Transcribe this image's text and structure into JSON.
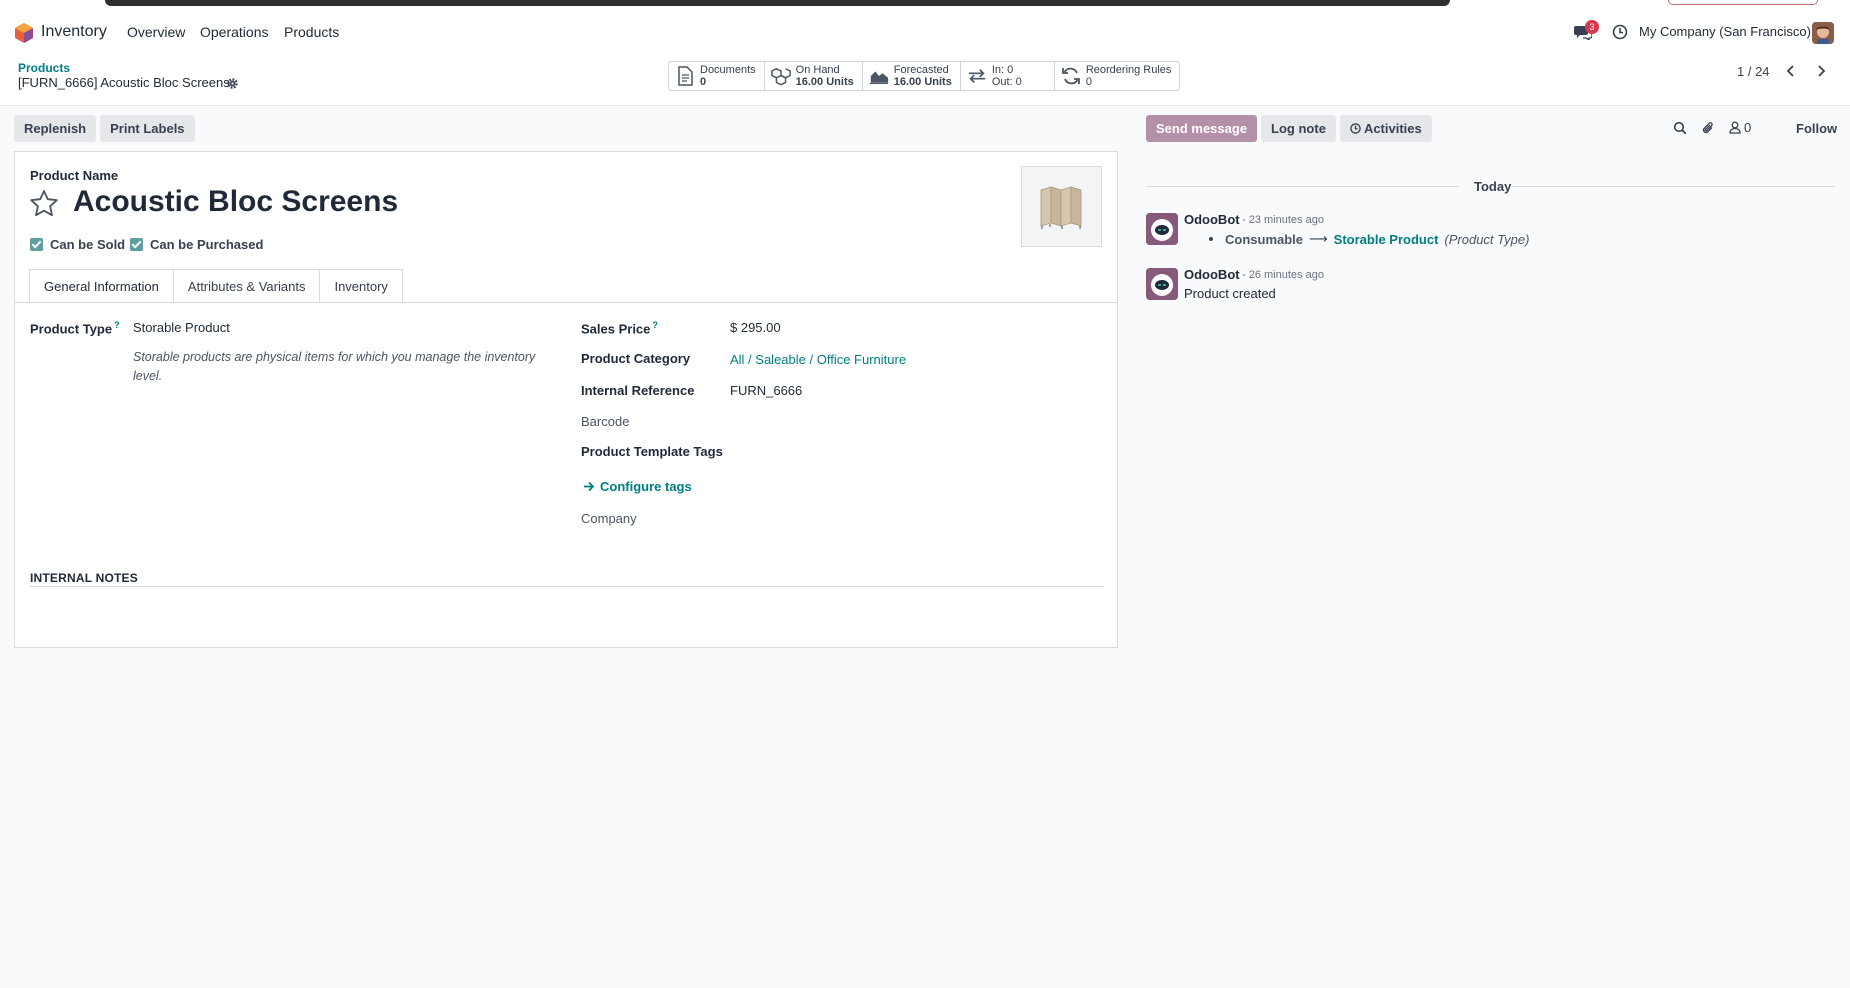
{
  "navbar": {
    "app_name": "Inventory",
    "menu": [
      "Overview",
      "Operations",
      "Products"
    ],
    "chat_count": "3",
    "company": "My Company (San Francisco)"
  },
  "control": {
    "breadcrumb": "Products",
    "record_title": "[FURN_6666] Acoustic Bloc Screens",
    "smart_buttons": [
      {
        "icon": "document-icon",
        "line1": "Documents",
        "line2": "0"
      },
      {
        "icon": "cubes-icon",
        "line1": "On Hand",
        "line2": "16.00 Units"
      },
      {
        "icon": "area-chart-icon",
        "line1": "Forecasted",
        "line2": "16.00 Units"
      },
      {
        "icon": "exchange-icon",
        "line1": "In: 0",
        "line2": "Out: 0"
      },
      {
        "icon": "refresh-icon",
        "line1": "Reordering Rules",
        "line2": "0"
      }
    ],
    "pager": "1 / 24"
  },
  "actions": {
    "replenish": "Replenish",
    "print_labels": "Print Labels"
  },
  "form": {
    "product_name_label": "Product Name",
    "product_name": "Acoustic Bloc Screens",
    "can_be_sold": "Can be Sold",
    "can_be_purchased": "Can be Purchased",
    "tabs": [
      "General Information",
      "Attributes & Variants",
      "Inventory"
    ],
    "product_type_label": "Product Type",
    "help_mark": "?",
    "product_type": "Storable Product",
    "product_type_help": "Storable products are physical items for which you manage the inventory level.",
    "sales_price_label": "Sales Price",
    "sales_price": "$ 295.00",
    "category_label": "Product Category",
    "category": "All / Saleable / Office Furniture",
    "internal_ref_label": "Internal Reference",
    "internal_ref": "FURN_6666",
    "barcode_label": "Barcode",
    "tags_label": "Product Template Tags",
    "configure_tags": "Configure tags",
    "company_label": "Company",
    "internal_notes": "INTERNAL NOTES"
  },
  "chatter": {
    "send_message": "Send message",
    "log_note": "Log note",
    "activities": "Activities",
    "followers": "0",
    "follow": "Follow",
    "today": "Today",
    "messages": [
      {
        "author": "OdooBot",
        "time": "- 23 minutes ago",
        "old": "Consumable",
        "arrow": "⟶",
        "new": "Storable Product",
        "field": "(Product Type)"
      },
      {
        "author": "OdooBot",
        "time": "- 26 minutes ago",
        "text": "Product created"
      }
    ]
  },
  "colors": {
    "accent": "#017e84",
    "primary": "#b590a9",
    "brand": "#875a7b"
  }
}
